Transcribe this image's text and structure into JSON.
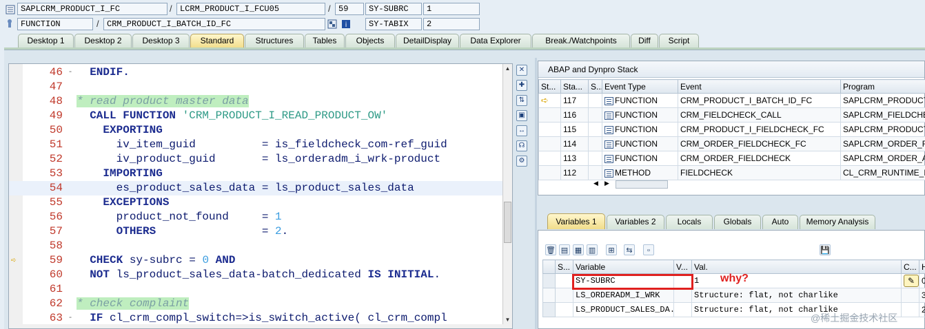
{
  "top": {
    "program": "SAPLCRM_PRODUCT_I_FC",
    "include": "LCRM_PRODUCT_I_FCU05",
    "line": "59",
    "sysvar1_name": "SY-SUBRC",
    "sysvar1_value": "1",
    "type": "FUNCTION",
    "name": "CRM_PRODUCT_I_BATCH_ID_FC",
    "sysvar2_name": "SY-TABIX",
    "sysvar2_value": "2",
    "sep": "/"
  },
  "tabs": [
    "Desktop 1",
    "Desktop 2",
    "Desktop 3",
    "Standard",
    "Structures",
    "Tables",
    "Objects",
    "DetailDisplay",
    "Data Explorer",
    "Break./Watchpoints",
    "Diff",
    "Script"
  ],
  "code": {
    "current_line": 59,
    "lines": [
      {
        "n": "46",
        "fold": "-",
        "tokens": [
          {
            "t": "  ",
            "c": ""
          },
          {
            "t": "ENDIF.",
            "c": "kw"
          }
        ]
      },
      {
        "n": "47",
        "tokens": []
      },
      {
        "n": "48",
        "tokens": [
          {
            "t": "* read product master data",
            "c": "cm"
          }
        ]
      },
      {
        "n": "49",
        "tokens": [
          {
            "t": "  ",
            "c": ""
          },
          {
            "t": "CALL FUNCTION ",
            "c": "kw"
          },
          {
            "t": "'CRM_PRODUCT_I_READ_PRODUCT_OW'",
            "c": "str"
          }
        ]
      },
      {
        "n": "50",
        "tokens": [
          {
            "t": "    ",
            "c": ""
          },
          {
            "t": "EXPORTING",
            "c": "kw"
          }
        ]
      },
      {
        "n": "51",
        "tokens": [
          {
            "t": "      iv_item_guid          ",
            "c": "id"
          },
          {
            "t": "= ",
            "c": "id"
          },
          {
            "t": "is_fieldcheck_com-ref_guid",
            "c": "id"
          }
        ]
      },
      {
        "n": "52",
        "tokens": [
          {
            "t": "      iv_product_guid       ",
            "c": "id"
          },
          {
            "t": "= ",
            "c": "id"
          },
          {
            "t": "ls_orderadm_i_wrk-product",
            "c": "id"
          }
        ]
      },
      {
        "n": "53",
        "tokens": [
          {
            "t": "    ",
            "c": ""
          },
          {
            "t": "IMPORTING",
            "c": "kw"
          }
        ]
      },
      {
        "n": "54",
        "cur": true,
        "tokens": [
          {
            "t": "      es_product_sales_data ",
            "c": "id"
          },
          {
            "t": "= ",
            "c": "id"
          },
          {
            "t": "ls_product_sales_data",
            "c": "id"
          }
        ]
      },
      {
        "n": "55",
        "tokens": [
          {
            "t": "    ",
            "c": ""
          },
          {
            "t": "EXCEPTIONS",
            "c": "kw"
          }
        ]
      },
      {
        "n": "56",
        "tokens": [
          {
            "t": "      product_not_found     ",
            "c": "id"
          },
          {
            "t": "= ",
            "c": "id"
          },
          {
            "t": "1",
            "c": "num"
          }
        ]
      },
      {
        "n": "57",
        "tokens": [
          {
            "t": "      ",
            "c": ""
          },
          {
            "t": "OTHERS",
            "c": "kw"
          },
          {
            "t": "                ",
            "c": ""
          },
          {
            "t": "= ",
            "c": "id"
          },
          {
            "t": "2",
            "c": "num"
          },
          {
            "t": ".",
            "c": "id"
          }
        ]
      },
      {
        "n": "58",
        "tokens": []
      },
      {
        "n": "59",
        "arrow": true,
        "tokens": [
          {
            "t": "  ",
            "c": ""
          },
          {
            "t": "CHECK ",
            "c": "kw"
          },
          {
            "t": "sy-subrc ",
            "c": "id"
          },
          {
            "t": "= ",
            "c": "id"
          },
          {
            "t": "0 ",
            "c": "num"
          },
          {
            "t": "AND",
            "c": "kw"
          }
        ]
      },
      {
        "n": "60",
        "tokens": [
          {
            "t": "  ",
            "c": ""
          },
          {
            "t": "NOT ",
            "c": "kw"
          },
          {
            "t": "ls_product_sales_data-batch_dedicated ",
            "c": "id"
          },
          {
            "t": "IS INITIAL",
            "c": "kw"
          },
          {
            "t": ".",
            "c": "id"
          }
        ]
      },
      {
        "n": "61",
        "tokens": []
      },
      {
        "n": "62",
        "tokens": [
          {
            "t": "* check complaint",
            "c": "cm"
          }
        ]
      },
      {
        "n": "63",
        "fold": "-",
        "tokens": [
          {
            "t": "  ",
            "c": ""
          },
          {
            "t": "IF ",
            "c": "kw"
          },
          {
            "t": "cl_crm_compl_switch=>is_switch_active( cl_crm_compl",
            "c": "id"
          }
        ]
      }
    ]
  },
  "stack": {
    "title": "ABAP and Dynpro Stack",
    "headers": [
      "St...",
      "Sta...",
      "S...",
      "Event Type",
      "Event",
      "Program"
    ],
    "rows": [
      {
        "level": "117",
        "type": "FUNCTION",
        "event": "CRM_PRODUCT_I_BATCH_ID_FC",
        "program": "SAPLCRM_PRODUCT_I",
        "current": true
      },
      {
        "level": "116",
        "type": "FUNCTION",
        "event": "CRM_FIELDCHECK_CALL",
        "program": "SAPLCRM_FIELDCHECK"
      },
      {
        "level": "115",
        "type": "FUNCTION",
        "event": "CRM_PRODUCT_I_FIELDCHECK_FC",
        "program": "SAPLCRM_PRODUCT_I"
      },
      {
        "level": "114",
        "type": "FUNCTION",
        "event": "CRM_ORDER_FIELDCHECK_FC",
        "program": "SAPLCRM_ORDER_FC"
      },
      {
        "level": "113",
        "type": "FUNCTION",
        "event": "CRM_ORDER_FIELDCHECK",
        "program": "SAPLCRM_ORDER_API"
      },
      {
        "level": "112",
        "type": "METHOD",
        "event": "FIELDCHECK",
        "program": "CL_CRM_RUNTIME_BT"
      }
    ]
  },
  "var_tabs": [
    "Variables 1",
    "Variables 2",
    "Locals",
    "Globals",
    "Auto",
    "Memory Analysis"
  ],
  "vars": {
    "headers": [
      "S...",
      "Variable",
      "V...",
      "Val.",
      "C...",
      "H"
    ],
    "rows": [
      {
        "name": "SY-SUBRC",
        "value": "1",
        "hex": "0"
      },
      {
        "name": "LS_ORDERADM_I_WRK",
        "value": "Structure: flat, not charlike",
        "hex": "3"
      },
      {
        "name": "LS_PRODUCT_SALES_DA...",
        "value": "Structure: flat, not charlike",
        "hex": "2"
      }
    ]
  },
  "annotation": "why?",
  "watermark": "@稀土掘金技术社区",
  "colors": {
    "keyword": "#1b2b8f",
    "string": "#2e9a86",
    "number": "#3b9de0",
    "comment_bg": "#bfeebf",
    "active_tab": "#f1dd8a",
    "highlight": "#e0201f"
  }
}
